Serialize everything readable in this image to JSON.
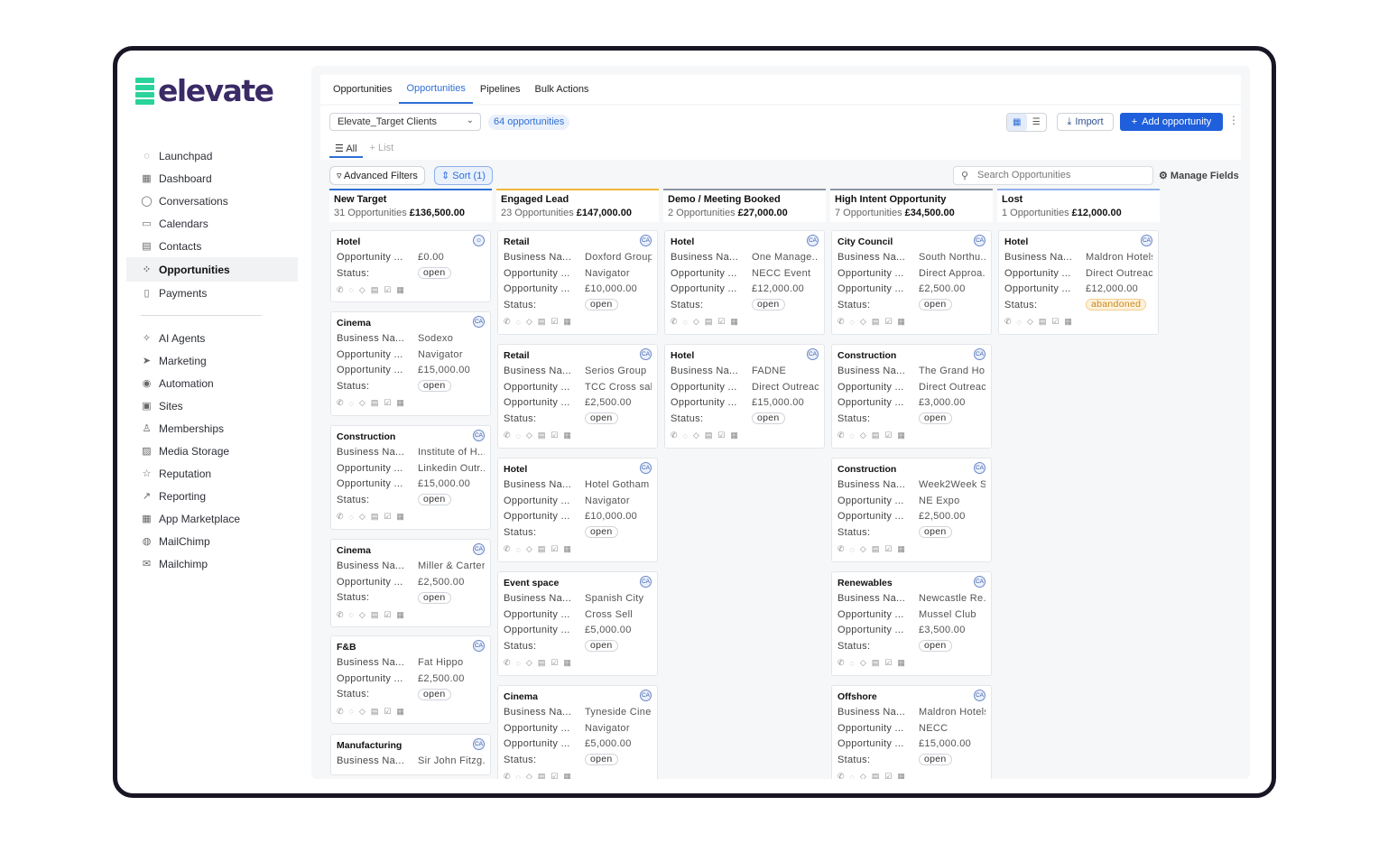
{
  "brand": {
    "name": "elevate",
    "accent": "#2ad39b"
  },
  "sidebar": {
    "items": [
      {
        "label": "Launchpad",
        "icon": "rocket-icon"
      },
      {
        "label": "Dashboard",
        "icon": "grid-icon"
      },
      {
        "label": "Conversations",
        "icon": "chat-icon"
      },
      {
        "label": "Calendars",
        "icon": "calendar-icon"
      },
      {
        "label": "Contacts",
        "icon": "contacts-icon"
      },
      {
        "label": "Opportunities",
        "icon": "opportunities-icon",
        "active": true
      },
      {
        "label": "Payments",
        "icon": "payments-icon"
      }
    ],
    "items2": [
      {
        "label": "AI Agents",
        "icon": "sparkle-icon"
      },
      {
        "label": "Marketing",
        "icon": "send-icon"
      },
      {
        "label": "Automation",
        "icon": "automation-icon"
      },
      {
        "label": "Sites",
        "icon": "sites-icon"
      },
      {
        "label": "Memberships",
        "icon": "membership-icon"
      },
      {
        "label": "Media Storage",
        "icon": "image-icon"
      },
      {
        "label": "Reputation",
        "icon": "star-icon"
      },
      {
        "label": "Reporting",
        "icon": "trend-icon"
      },
      {
        "label": "App Marketplace",
        "icon": "apps-icon"
      },
      {
        "label": "MailChimp",
        "icon": "wordpress-icon"
      },
      {
        "label": "Mailchimp",
        "icon": "mailchimp-icon"
      }
    ]
  },
  "tabs": [
    "Opportunities",
    "Opportunities",
    "Pipelines",
    "Bulk Actions"
  ],
  "toolbar": {
    "pipeline": "Elevate_Target Clients",
    "count": "64 opportunities",
    "import": "Import",
    "add": "Add opportunity"
  },
  "subtabs": {
    "all": "All",
    "list": "+ List"
  },
  "filters": {
    "advanced": "Advanced Filters",
    "sort": "Sort (1)",
    "search_placeholder": "Search Opportunities",
    "manage": "Manage Fields"
  },
  "columns": [
    {
      "title": "New Target",
      "count": "31 Opportunities",
      "total": "£136,500.00",
      "color": "#2f6fd6",
      "cards": [
        {
          "title": "Hotel",
          "rows": [
            [
              "Opportunity ...",
              "£0.00"
            ]
          ],
          "status": "open",
          "avatar": "person"
        },
        {
          "title": "Cinema",
          "rows": [
            [
              "Business Na...",
              "Sodexo"
            ],
            [
              "Opportunity ...",
              "Navigator"
            ],
            [
              "Opportunity ...",
              "£15,000.00"
            ]
          ],
          "status": "open"
        },
        {
          "title": "Construction",
          "rows": [
            [
              "Business Na...",
              "Institute of H..."
            ],
            [
              "Opportunity ...",
              "Linkedin Outr..."
            ],
            [
              "Opportunity ...",
              "£15,000.00"
            ]
          ],
          "status": "open"
        },
        {
          "title": "Cinema",
          "rows": [
            [
              "Business Na...",
              "Miller & Carter"
            ],
            [
              "Opportunity ...",
              "£2,500.00"
            ]
          ],
          "status": "open"
        },
        {
          "title": "F&B",
          "rows": [
            [
              "Business Na...",
              "Fat Hippo"
            ],
            [
              "Opportunity ...",
              "£2,500.00"
            ]
          ],
          "status": "open"
        },
        {
          "title": "Manufacturing",
          "rows": [
            [
              "Business Na...",
              "Sir John Fitzg..."
            ]
          ],
          "status": ""
        }
      ]
    },
    {
      "title": "Engaged Lead",
      "count": "23 Opportunities",
      "total": "£147,000.00",
      "color": "#f0b63a",
      "cards": [
        {
          "title": "Retail",
          "rows": [
            [
              "Business Na...",
              "Doxford Group"
            ],
            [
              "Opportunity ...",
              "Navigator"
            ],
            [
              "Opportunity ...",
              "£10,000.00"
            ]
          ],
          "status": "open"
        },
        {
          "title": "Retail",
          "rows": [
            [
              "Business Na...",
              "Serios Group"
            ],
            [
              "Opportunity ...",
              "TCC Cross sale"
            ],
            [
              "Opportunity ...",
              "£2,500.00"
            ]
          ],
          "status": "open"
        },
        {
          "title": "Hotel",
          "rows": [
            [
              "Business Na...",
              "Hotel Gotham"
            ],
            [
              "Opportunity ...",
              "Navigator"
            ],
            [
              "Opportunity ...",
              "£10,000.00"
            ]
          ],
          "status": "open"
        },
        {
          "title": "Event space",
          "rows": [
            [
              "Business Na...",
              "Spanish City"
            ],
            [
              "Opportunity ...",
              "Cross Sell"
            ],
            [
              "Opportunity ...",
              "£5,000.00"
            ]
          ],
          "status": "open"
        },
        {
          "title": "Cinema",
          "rows": [
            [
              "Business Na...",
              "Tyneside Cine..."
            ],
            [
              "Opportunity ...",
              "Navigator"
            ],
            [
              "Opportunity ...",
              "£5,000.00"
            ]
          ],
          "status": "open"
        }
      ]
    },
    {
      "title": "Demo / Meeting Booked",
      "count": "2 Opportunities",
      "total": "£27,000.00",
      "color": "#8c96a3",
      "cards": [
        {
          "title": "Hotel",
          "rows": [
            [
              "Business Na...",
              "One Manage..."
            ],
            [
              "Opportunity ...",
              "NECC Event"
            ],
            [
              "Opportunity ...",
              "£12,000.00"
            ]
          ],
          "status": "open"
        },
        {
          "title": "Hotel",
          "rows": [
            [
              "Business Na...",
              "FADNE"
            ],
            [
              "Opportunity ...",
              "Direct Outreach"
            ],
            [
              "Opportunity ...",
              "£15,000.00"
            ]
          ],
          "status": "open"
        }
      ]
    },
    {
      "title": "High Intent Opportunity",
      "count": "7 Opportunities",
      "total": "£34,500.00",
      "color": "#8c96a3",
      "cards": [
        {
          "title": "City Council",
          "rows": [
            [
              "Business Na...",
              "South Northu..."
            ],
            [
              "Opportunity ...",
              "Direct Approa..."
            ],
            [
              "Opportunity ...",
              "£2,500.00"
            ]
          ],
          "status": "open"
        },
        {
          "title": "Construction",
          "rows": [
            [
              "Business Na...",
              "The Grand Ho..."
            ],
            [
              "Opportunity ...",
              "Direct Outreach"
            ],
            [
              "Opportunity ...",
              "£3,000.00"
            ]
          ],
          "status": "open"
        },
        {
          "title": "Construction",
          "rows": [
            [
              "Business Na...",
              "Week2Week S..."
            ],
            [
              "Opportunity ...",
              "NE Expo"
            ],
            [
              "Opportunity ...",
              "£2,500.00"
            ]
          ],
          "status": "open"
        },
        {
          "title": "Renewables",
          "rows": [
            [
              "Business Na...",
              "Newcastle Re..."
            ],
            [
              "Opportunity ...",
              "Mussel Club"
            ],
            [
              "Opportunity ...",
              "£3,500.00"
            ]
          ],
          "status": "open"
        },
        {
          "title": "Offshore",
          "rows": [
            [
              "Business Na...",
              "Maldron Hotels"
            ],
            [
              "Opportunity ...",
              "NECC"
            ],
            [
              "Opportunity ...",
              "£15,000.00"
            ]
          ],
          "status": "open"
        }
      ]
    },
    {
      "title": "Lost",
      "count": "1 Opportunities",
      "total": "£12,000.00",
      "color": "#8fb1ea",
      "cards": [
        {
          "title": "Hotel",
          "rows": [
            [
              "Business Na...",
              "Maldron Hotels"
            ],
            [
              "Opportunity ...",
              "Direct Outreach"
            ],
            [
              "Opportunity ...",
              "£12,000.00"
            ]
          ],
          "status": "abandoned"
        }
      ]
    }
  ],
  "labels": {
    "status": "Status:",
    "avatar": "CA"
  }
}
